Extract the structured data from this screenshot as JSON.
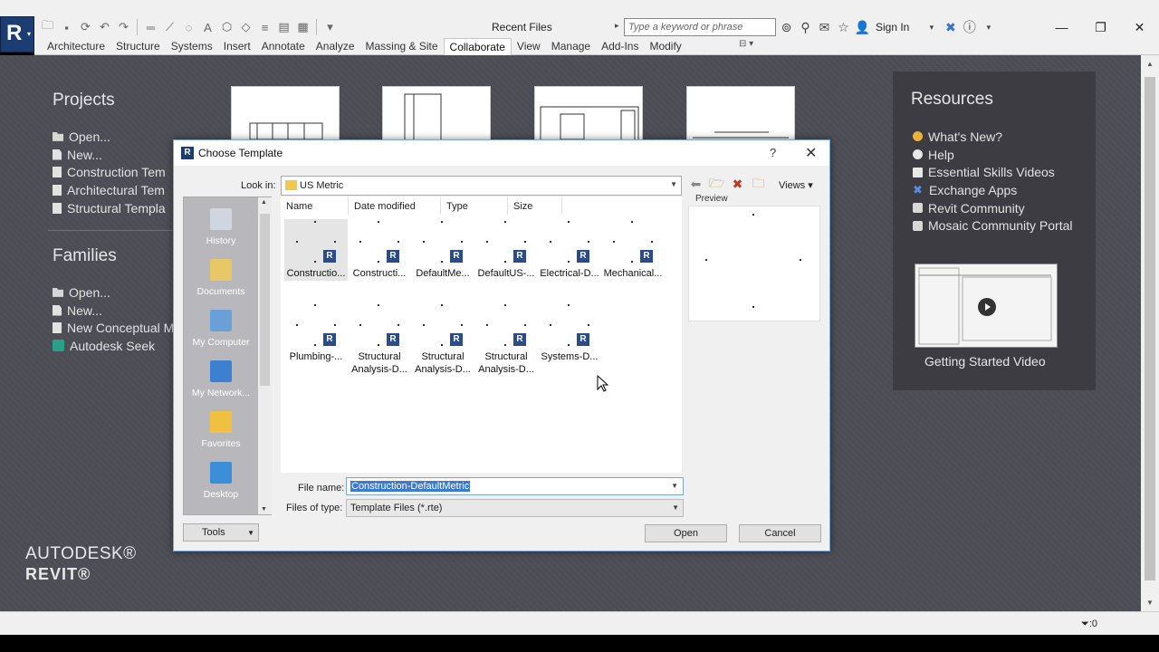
{
  "titlebar": {
    "title": "Recent Files",
    "search_placeholder": "Type a keyword or phrase",
    "signin": "Sign In"
  },
  "ribbon": {
    "tabs": [
      {
        "label": "Architecture",
        "active": false
      },
      {
        "label": "Structure",
        "active": false
      },
      {
        "label": "Systems",
        "active": false
      },
      {
        "label": "Insert",
        "active": false
      },
      {
        "label": "Annotate",
        "active": false
      },
      {
        "label": "Analyze",
        "active": false
      },
      {
        "label": "Massing & Site",
        "active": false
      },
      {
        "label": "Collaborate",
        "active": true
      },
      {
        "label": "View",
        "active": false
      },
      {
        "label": "Manage",
        "active": false
      },
      {
        "label": "Add-Ins",
        "active": false
      },
      {
        "label": "Modify",
        "active": false
      }
    ]
  },
  "projects": {
    "heading": "Projects",
    "items": [
      "Open...",
      "New...",
      "Construction Tem",
      "Architectural Tem",
      "Structural Templa"
    ]
  },
  "families": {
    "heading": "Families",
    "items": [
      "Open...",
      "New...",
      "New Conceptual M",
      "Autodesk Seek"
    ]
  },
  "resources": {
    "heading": "Resources",
    "items": [
      "What's New?",
      "Help",
      "Essential Skills Videos",
      "Exchange Apps",
      "Revit Community",
      "Mosaic Community Portal"
    ],
    "video_caption": "Getting Started Video"
  },
  "brand": {
    "line1": "AUTODESK®",
    "line2": "REVIT®"
  },
  "status": {
    "filter": ":0"
  },
  "dialog": {
    "title": "Choose Template",
    "help": "?",
    "lookin_label": "Look in:",
    "lookin_value": "US Metric",
    "views_label": "Views",
    "preview_label": "Preview",
    "places": [
      "History",
      "Documents",
      "My Computer",
      "My Network...",
      "Favorites",
      "Desktop"
    ],
    "columns": [
      "Name",
      "Date modified",
      "Type",
      "Size"
    ],
    "files": [
      {
        "name": "Constructio...",
        "selected": true
      },
      {
        "name": "Constructi...",
        "selected": false
      },
      {
        "name": "DefaultMe...",
        "selected": false
      },
      {
        "name": "DefaultUS-...",
        "selected": false
      },
      {
        "name": "Electrical-D...",
        "selected": false
      },
      {
        "name": "Mechanical...",
        "selected": false
      },
      {
        "name": "Plumbing-...",
        "selected": false
      },
      {
        "name": "Structural Analysis-D...",
        "selected": false
      },
      {
        "name": "Structural Analysis-D...",
        "selected": false
      },
      {
        "name": "Structural Analysis-D...",
        "selected": false
      },
      {
        "name": "Systems-D...",
        "selected": false
      }
    ],
    "filename_label": "File name:",
    "filename_value": "Construction-DefaultMetric",
    "filetype_label": "Files of type:",
    "filetype_value": "Template Files  (*.rte)",
    "tools_label": "Tools",
    "open_label": "Open",
    "cancel_label": "Cancel"
  }
}
